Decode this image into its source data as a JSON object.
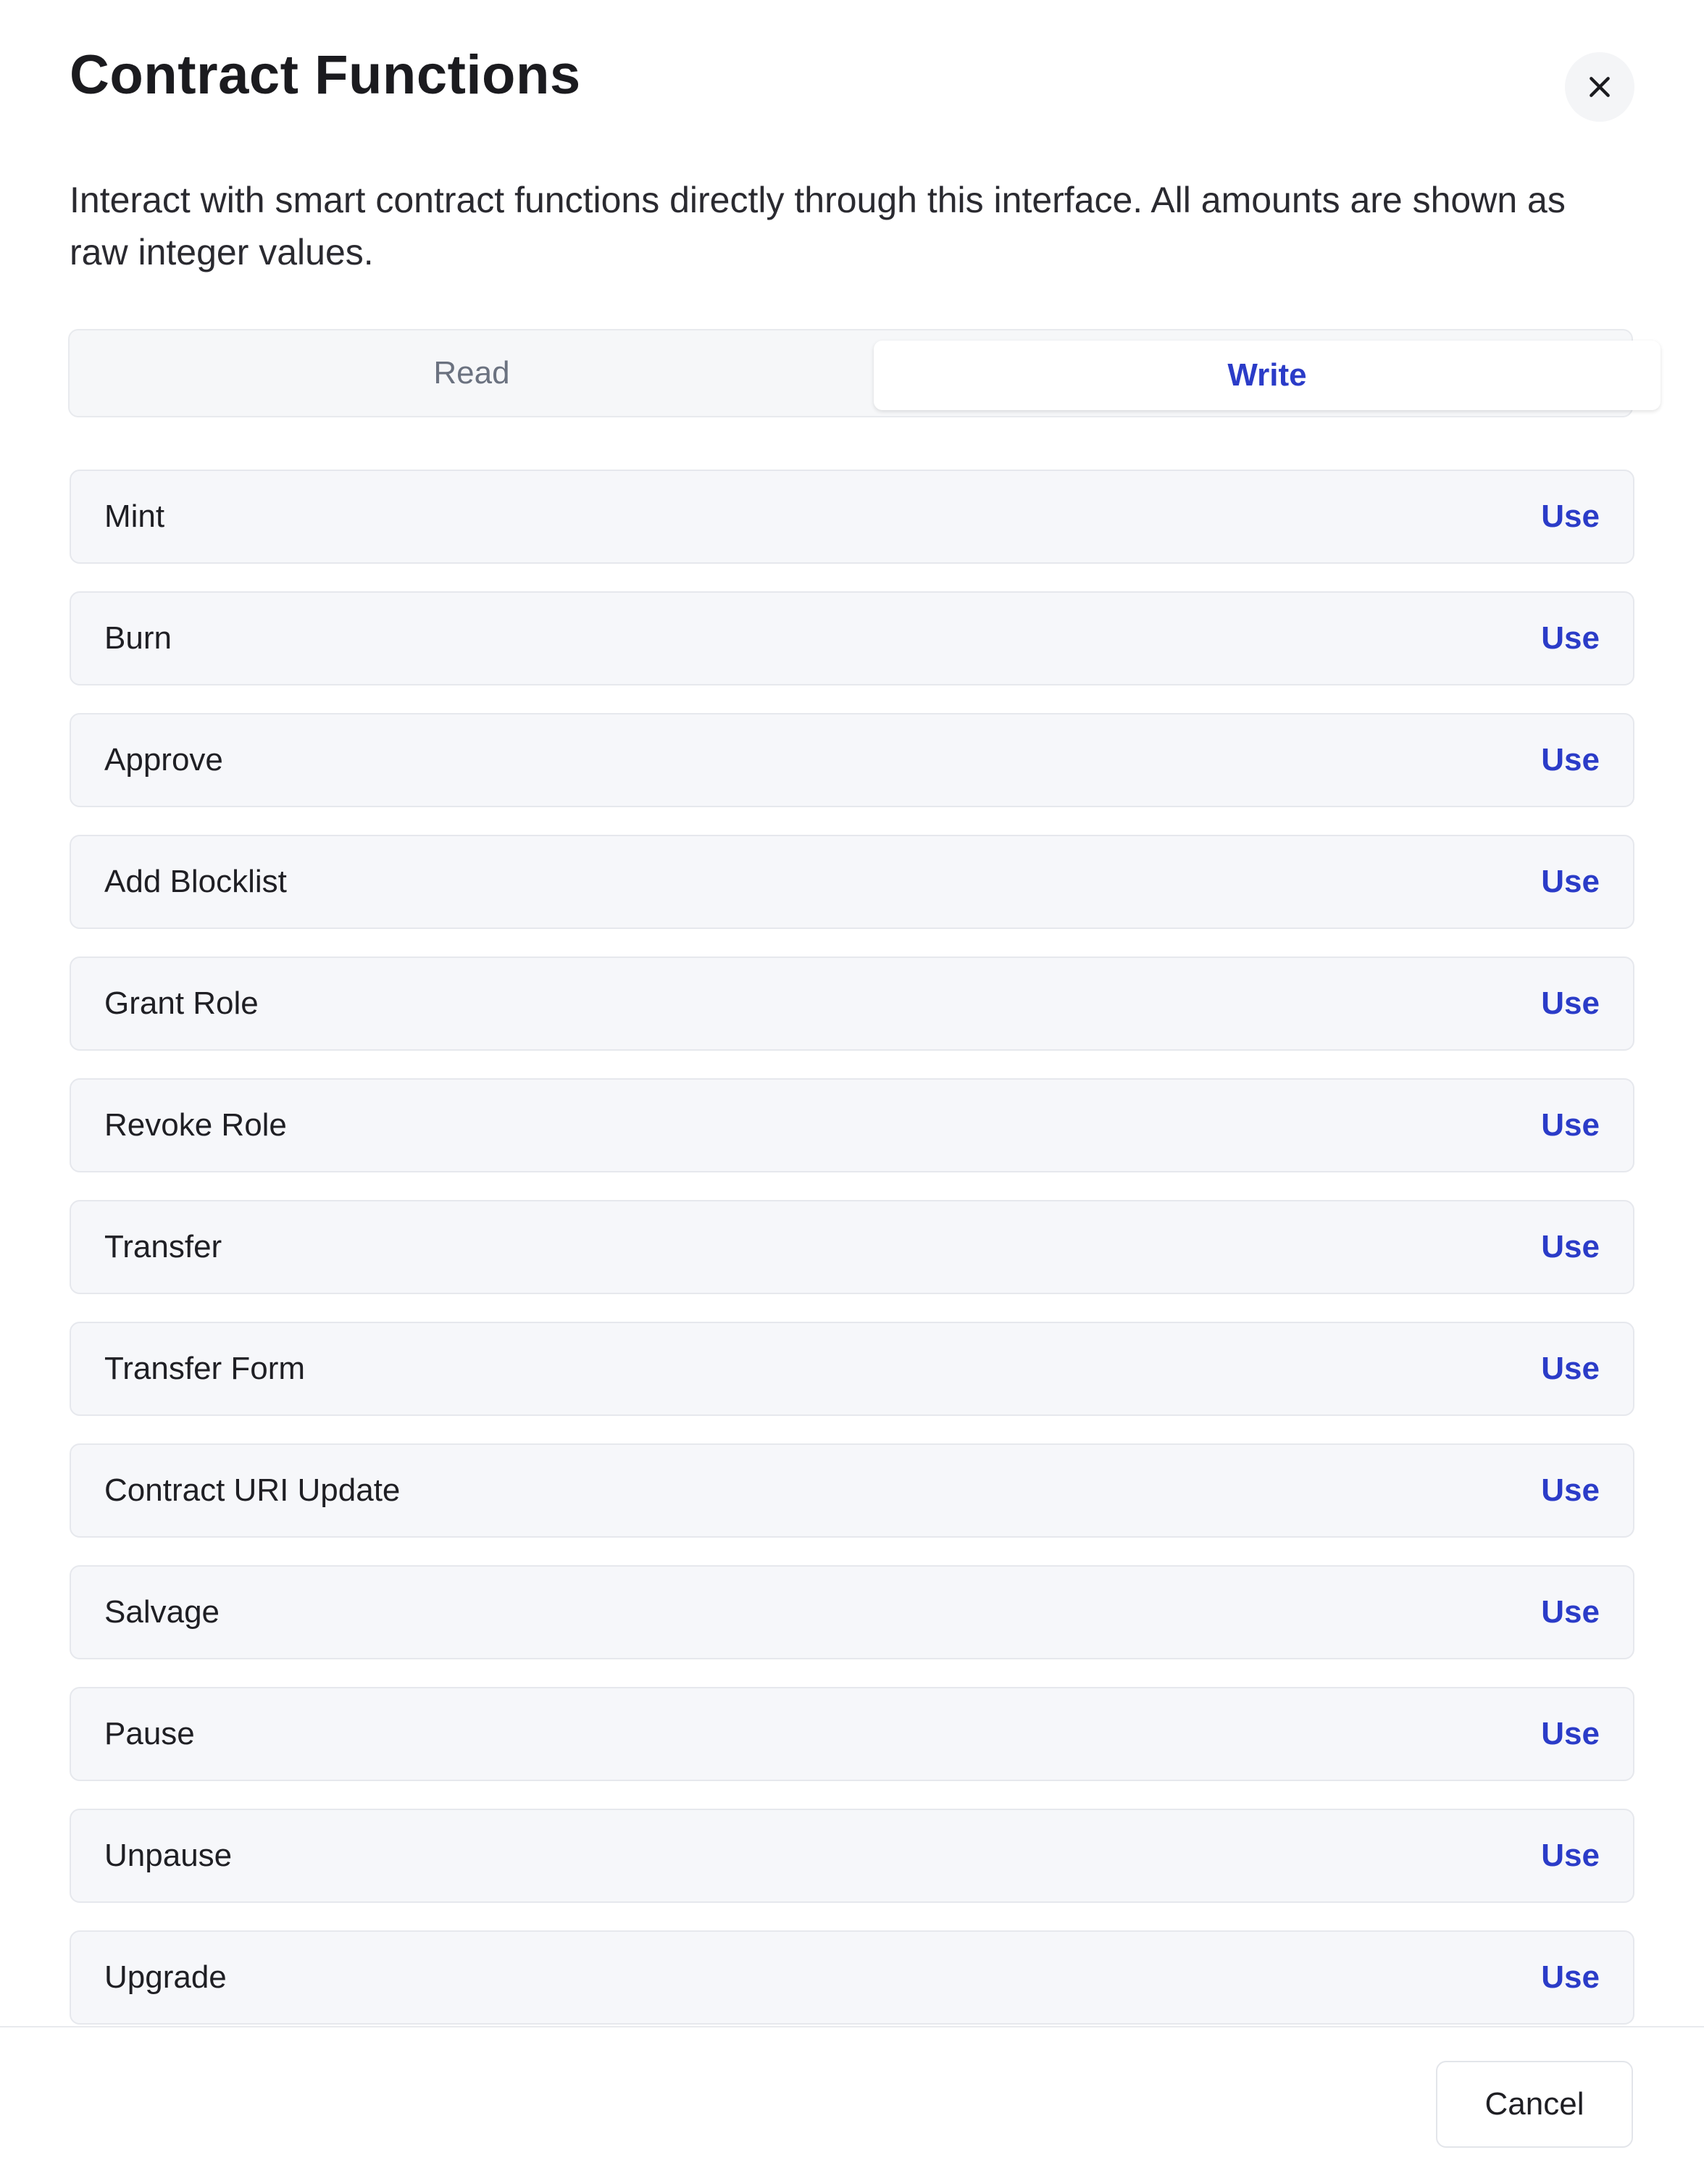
{
  "dialog": {
    "title": "Contract Functions",
    "description": "Interact with smart contract functions directly through this interface. All amounts are shown as raw integer values.",
    "close_icon": "close-icon"
  },
  "tabs": {
    "read_label": "Read",
    "write_label": "Write",
    "active": "Write"
  },
  "functions": [
    {
      "label": "Mint",
      "action": "Use"
    },
    {
      "label": "Burn",
      "action": "Use"
    },
    {
      "label": "Approve",
      "action": "Use"
    },
    {
      "label": "Add Blocklist",
      "action": "Use"
    },
    {
      "label": "Grant Role",
      "action": "Use"
    },
    {
      "label": "Revoke Role",
      "action": "Use"
    },
    {
      "label": "Transfer",
      "action": "Use"
    },
    {
      "label": "Transfer Form",
      "action": "Use"
    },
    {
      "label": "Contract URI Update",
      "action": "Use"
    },
    {
      "label": "Salvage",
      "action": "Use"
    },
    {
      "label": "Pause",
      "action": "Use"
    },
    {
      "label": "Unpause",
      "action": "Use"
    },
    {
      "label": "Upgrade",
      "action": "Use"
    }
  ],
  "footer": {
    "cancel_label": "Cancel"
  },
  "colors": {
    "accent": "#2b3cc8",
    "row_background": "#f6f7fa",
    "muted_text": "#6b7280"
  }
}
